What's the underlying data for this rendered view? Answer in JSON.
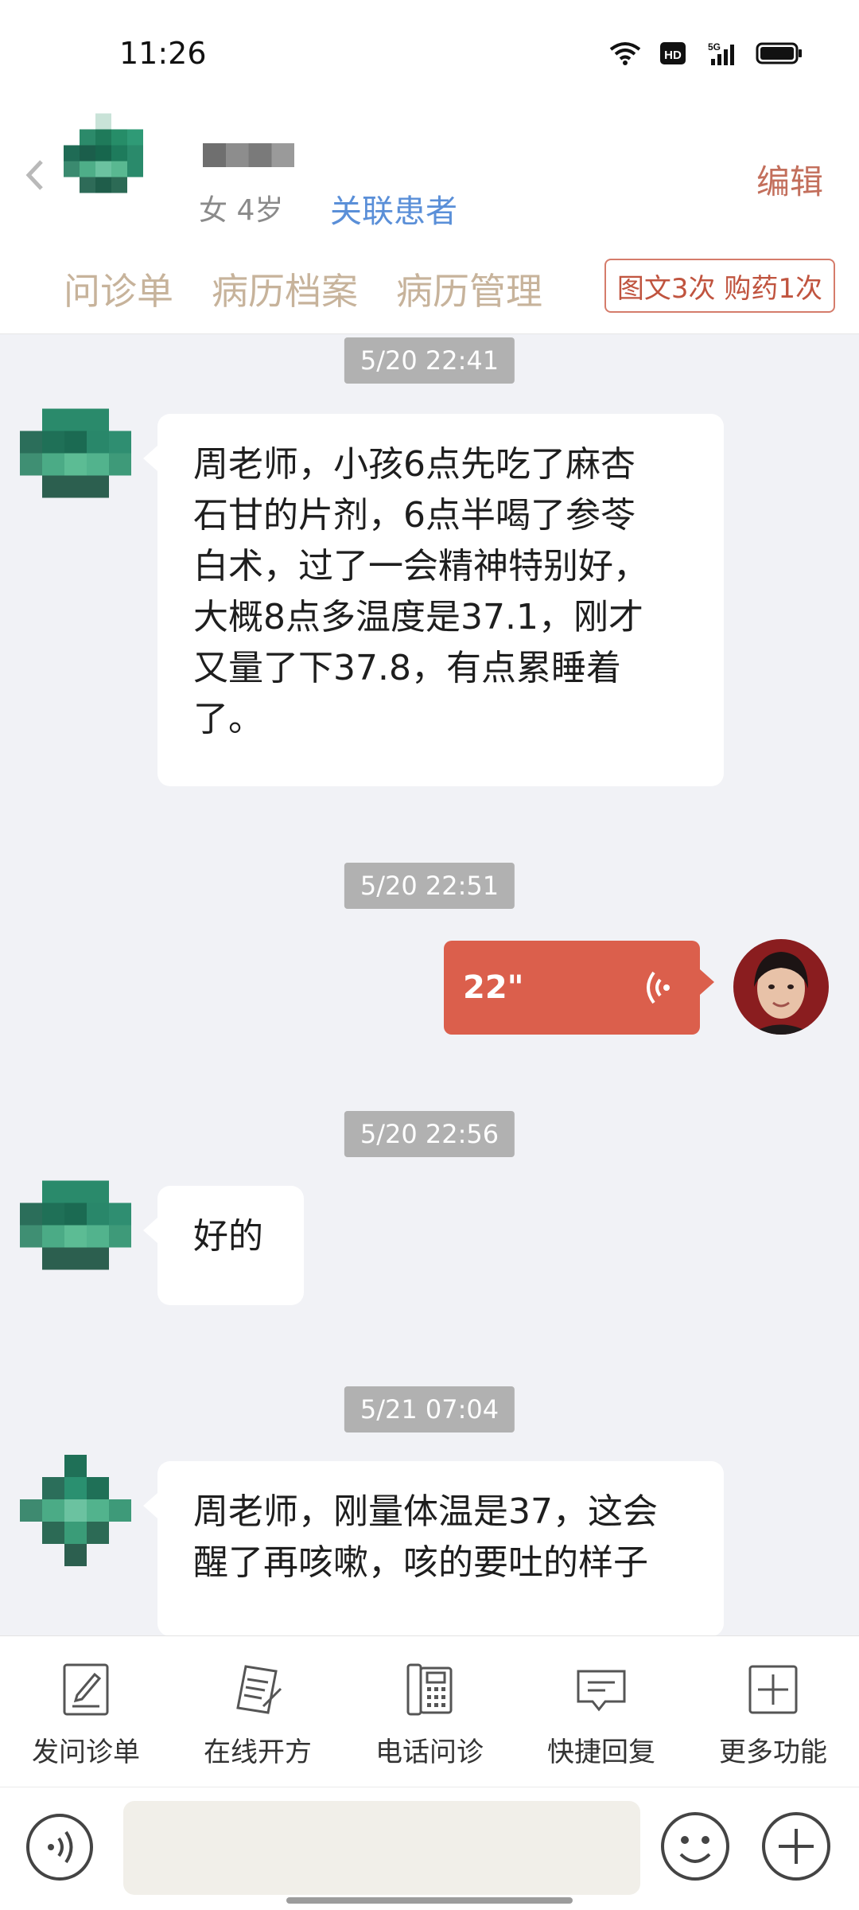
{
  "status_bar": {
    "time": "11:26",
    "network": "5G",
    "hd": "HD"
  },
  "header": {
    "gender_age": "女 4岁",
    "link_patient": "关联患者",
    "edit": "编辑",
    "tabs": [
      "问诊单",
      "病历档案",
      "病历管理"
    ],
    "quota": "图文3次 购药1次"
  },
  "chat": {
    "messages": [
      {
        "timestamp": "5/20 22:41",
        "type": "text",
        "from": "patient",
        "lines": [
          "周老师，小孩6点先吃了麻杏",
          "石甘的片剂，6点半喝了参苓",
          "白术，过了一会精神特别好，",
          "大概8点多温度是37.1，刚才",
          "又量了下37.8，有点累睡着",
          "了。"
        ]
      },
      {
        "timestamp": "5/20 22:51",
        "type": "voice",
        "from": "doctor",
        "duration": "22\""
      },
      {
        "timestamp": "5/20 22:56",
        "type": "text",
        "from": "patient",
        "lines": [
          "好的"
        ]
      },
      {
        "timestamp": "5/21 07:04",
        "type": "text",
        "from": "patient",
        "lines": [
          "周老师，刚量体温是37，这会",
          "醒了再咳嗽，咳的要吐的样子"
        ]
      }
    ]
  },
  "toolbar": {
    "items": [
      {
        "label": "发问诊单",
        "icon": "form-edit-icon"
      },
      {
        "label": "在线开方",
        "icon": "prescription-icon"
      },
      {
        "label": "电话问诊",
        "icon": "phone-icon"
      },
      {
        "label": "快捷回复",
        "icon": "quick-reply-icon"
      },
      {
        "label": "更多功能",
        "icon": "plus-square-icon"
      }
    ]
  },
  "input_bar": {
    "placeholder": ""
  },
  "colors": {
    "accent": "#db5f4c",
    "link": "#5a8fd8",
    "tab": "#c7b39b",
    "timestamp_bg": "#b1b1b1"
  }
}
